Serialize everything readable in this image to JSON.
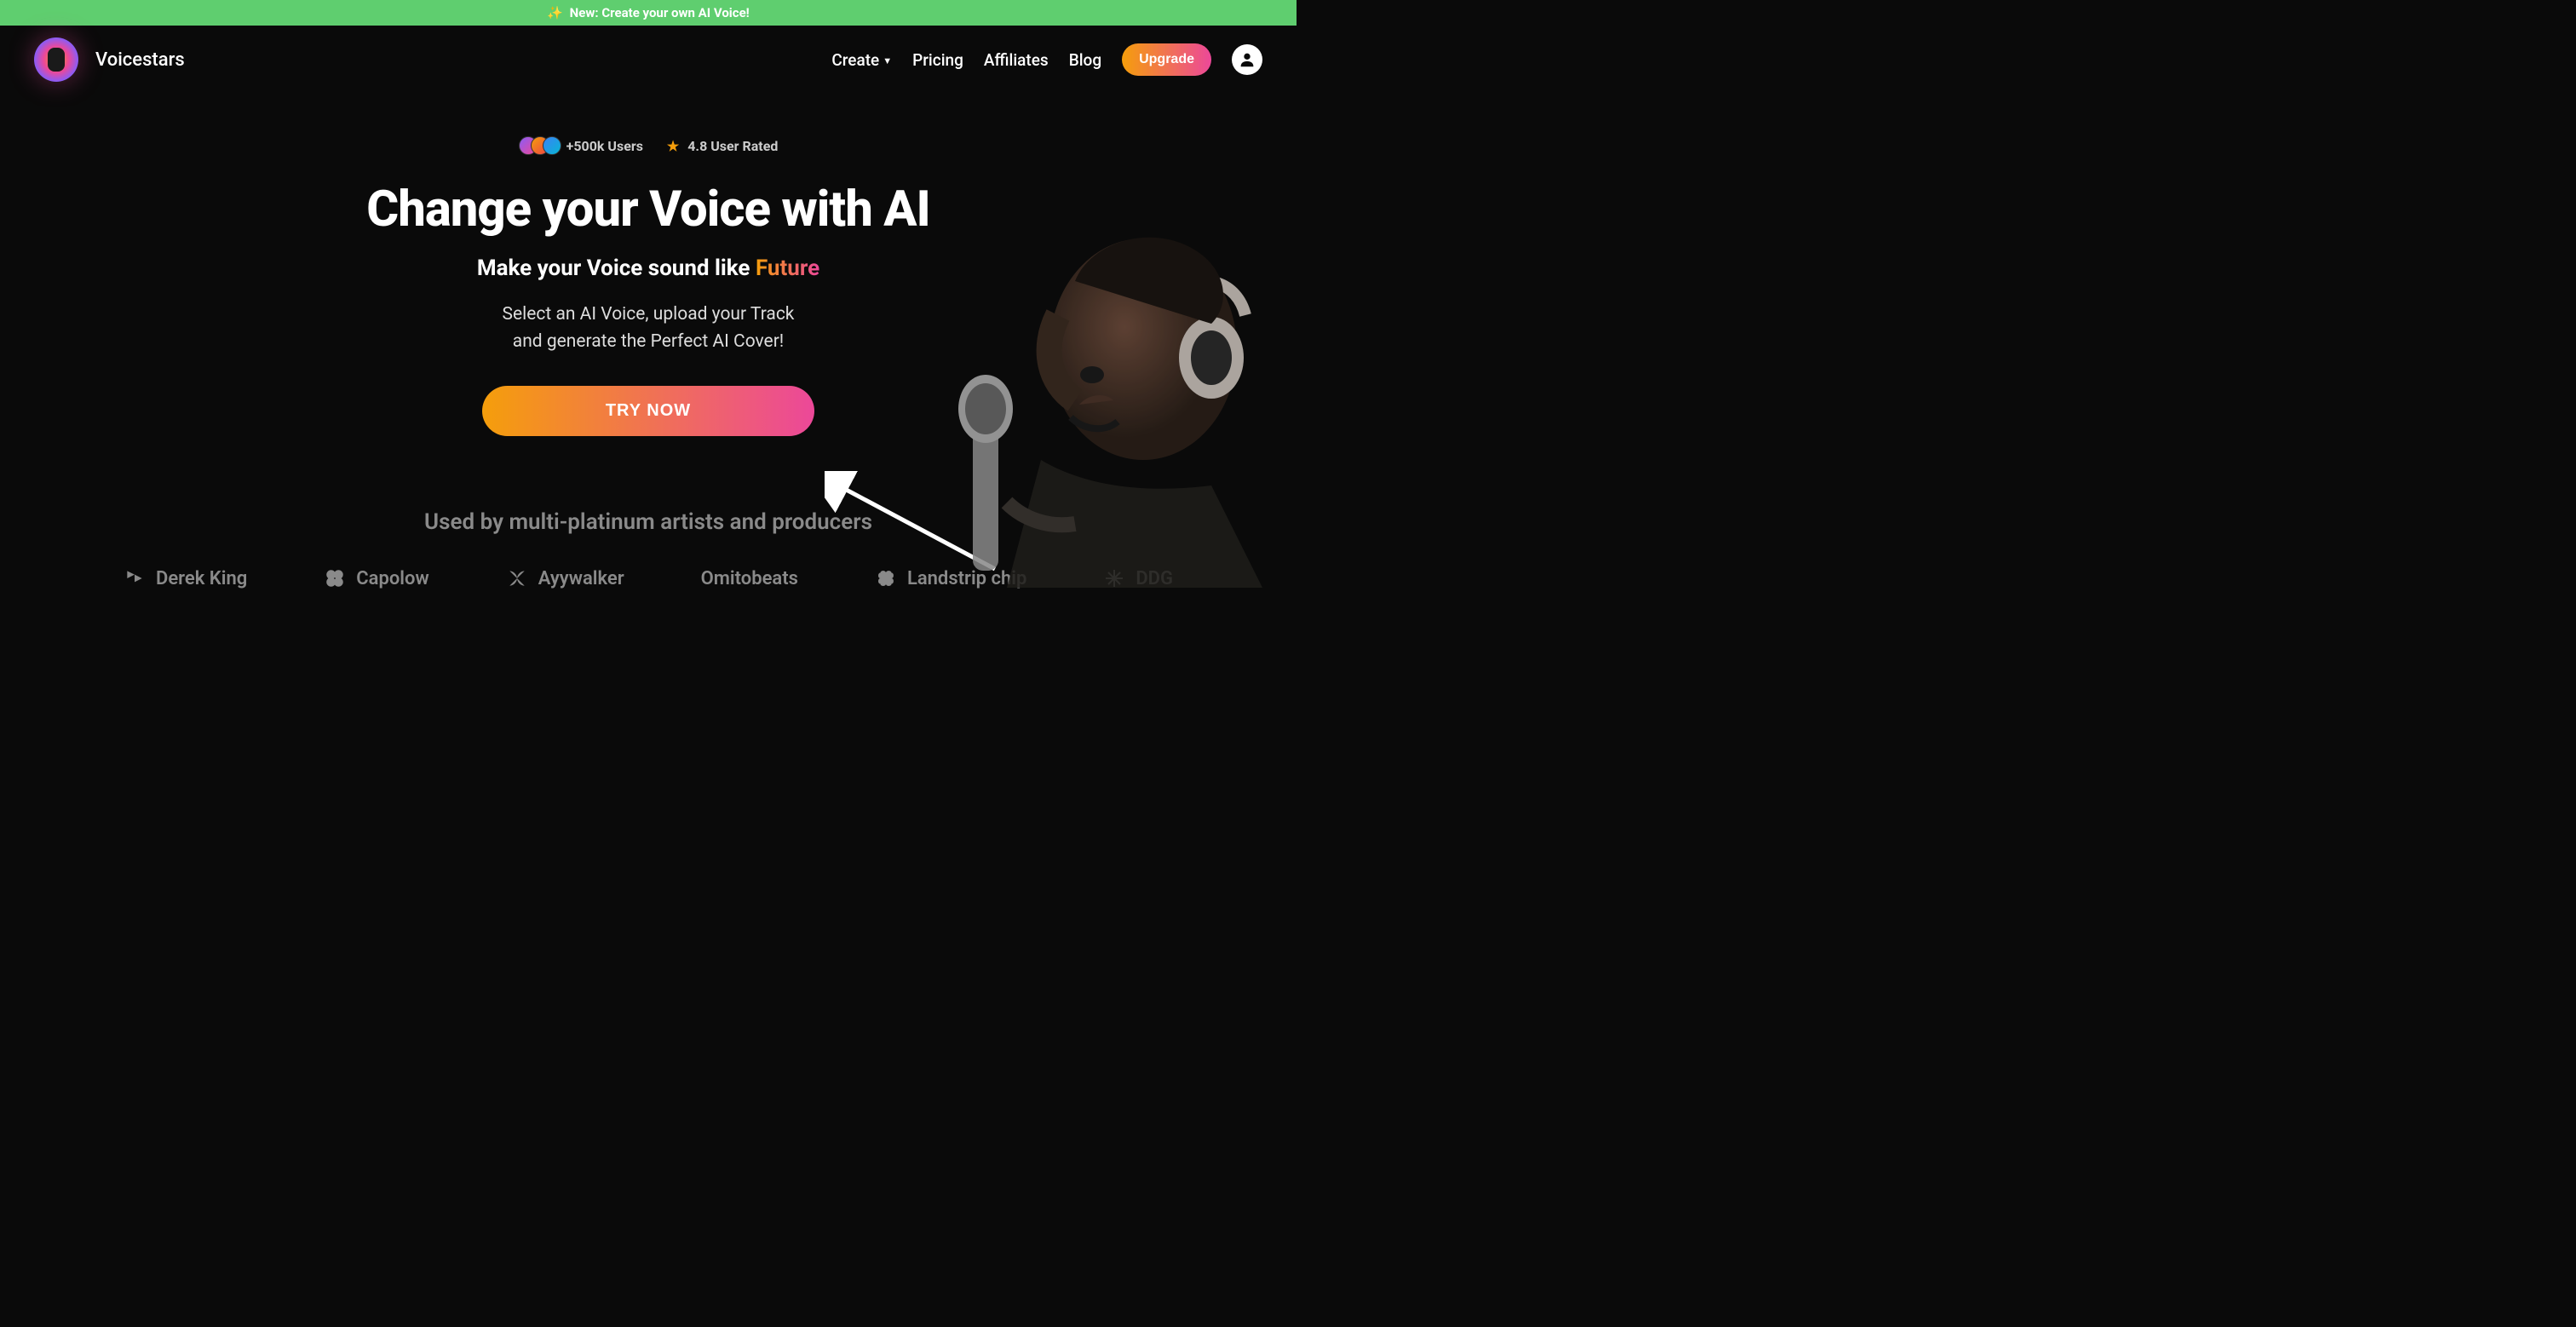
{
  "announcement": {
    "sparkle": "✨",
    "text": "New: Create your own AI Voice!"
  },
  "brand": {
    "name": "Voicestars"
  },
  "nav": {
    "create": "Create",
    "pricing": "Pricing",
    "affiliates": "Affiliates",
    "blog": "Blog",
    "upgrade": "Upgrade"
  },
  "hero": {
    "stats": {
      "users": "+500k Users",
      "rating": "4.8 User Rated"
    },
    "title": "Change your Voice with AI",
    "subtitle_prefix": "Make your Voice sound like ",
    "subtitle_highlight": "Future",
    "description_line1": "Select an AI Voice, upload your Track",
    "description_line2": "and generate the Perfect AI Cover!",
    "cta": "TRY NOW"
  },
  "social_proof": {
    "title": "Used by multi-platinum artists and producers",
    "artists": [
      "Derek King",
      "Capolow",
      "Ayywalker",
      "Omitobeats",
      "Landstrip chip",
      "DDG"
    ]
  }
}
